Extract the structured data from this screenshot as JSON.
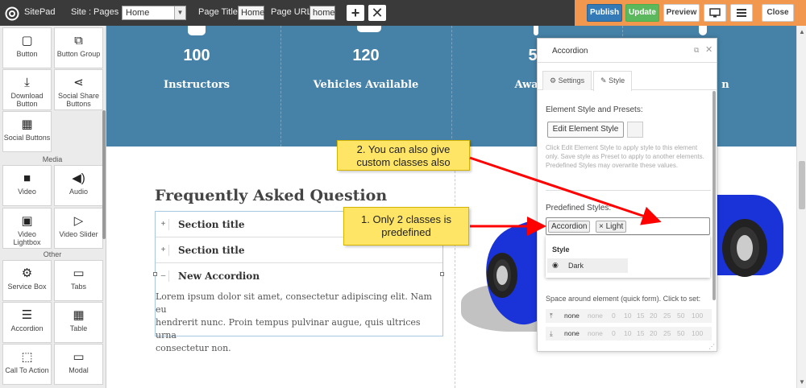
{
  "topbar": {
    "app_name": "SitePad",
    "site_label": "Site :",
    "pages_label": "Pages :",
    "pages_select": "Home",
    "page_title_label": "Page Title:",
    "page_title_value": "Home",
    "page_url_label": "Page URL:",
    "page_url_value": "home",
    "publish": "Publish",
    "update": "Update",
    "preview": "Preview",
    "close": "Close",
    "colors": {
      "publish": "#337ab7",
      "update": "#5cb85c",
      "accent": "#f1974e"
    }
  },
  "sidebar": {
    "tiles": [
      {
        "label": "Button",
        "icon": "button-icon"
      },
      {
        "label": "Button Group",
        "icon": "button-group-icon"
      },
      {
        "label": "Download Button",
        "icon": "download-icon"
      },
      {
        "label": "Social Share Buttons",
        "icon": "share-icon"
      },
      {
        "label": "Social Buttons",
        "icon": "social-icon"
      }
    ],
    "media_label": "Media",
    "media_tiles": [
      {
        "label": "Video",
        "icon": "video-icon"
      },
      {
        "label": "Audio",
        "icon": "audio-icon"
      },
      {
        "label": "Video Lightbox",
        "icon": "film-icon"
      },
      {
        "label": "Video Slider",
        "icon": "video-slider-icon"
      }
    ],
    "other_label": "Other",
    "other_tiles": [
      {
        "label": "Service Box",
        "icon": "service-box-icon"
      },
      {
        "label": "Tabs",
        "icon": "tabs-icon"
      },
      {
        "label": "Accordion",
        "icon": "accordion-icon"
      },
      {
        "label": "Table",
        "icon": "table-icon"
      },
      {
        "label": "Call To Action",
        "icon": "call-to-action-icon"
      },
      {
        "label": "Modal",
        "icon": "modal-icon"
      }
    ]
  },
  "stats": [
    {
      "number": "100",
      "label": "Instructors"
    },
    {
      "number": "120",
      "label": "Vehicles Available"
    },
    {
      "number": "5",
      "label": "Award"
    },
    {
      "number": "",
      "label": "n"
    }
  ],
  "faq": {
    "title": "Frequently Asked Question",
    "items": [
      {
        "toggle": "+",
        "title": "Section title"
      },
      {
        "toggle": "+",
        "title": "Section title"
      },
      {
        "toggle": "–",
        "title": "New Accordion"
      }
    ],
    "body_lines": [
      "Lorem ipsum dolor sit amet, consectetur adipiscing elit. Nam eu",
      "hendrerit nunc. Proin tempus pulvinar augue, quis ultrices urna",
      "consectetur non."
    ]
  },
  "panel": {
    "title": "Accordion",
    "tab_settings": "Settings",
    "tab_style": "Style",
    "section_label": "Element Style and Presets:",
    "edit_button": "Edit Element Style",
    "note": "Click Edit Element Style to apply style to this element only. Save style as Preset to apply to another elements. Predefined Styles may overwrite these values.",
    "predefined_label": "Predefined Styles:",
    "tags": [
      "Accordion",
      "Light"
    ],
    "tag_remove": "×",
    "dropdown_group": "Style",
    "dropdown_option": "Dark",
    "spacing_label": "Space around element (quick form). Click to set:",
    "spacing_values": [
      "none",
      "none",
      "0",
      "10",
      "15",
      "20",
      "25",
      "50",
      "100"
    ]
  },
  "callouts": {
    "one": [
      "1. Only 2 classes is",
      "predefined"
    ],
    "two": [
      "2. You can also give",
      "custom classes also"
    ],
    "arrow_color": "#ff0000"
  }
}
